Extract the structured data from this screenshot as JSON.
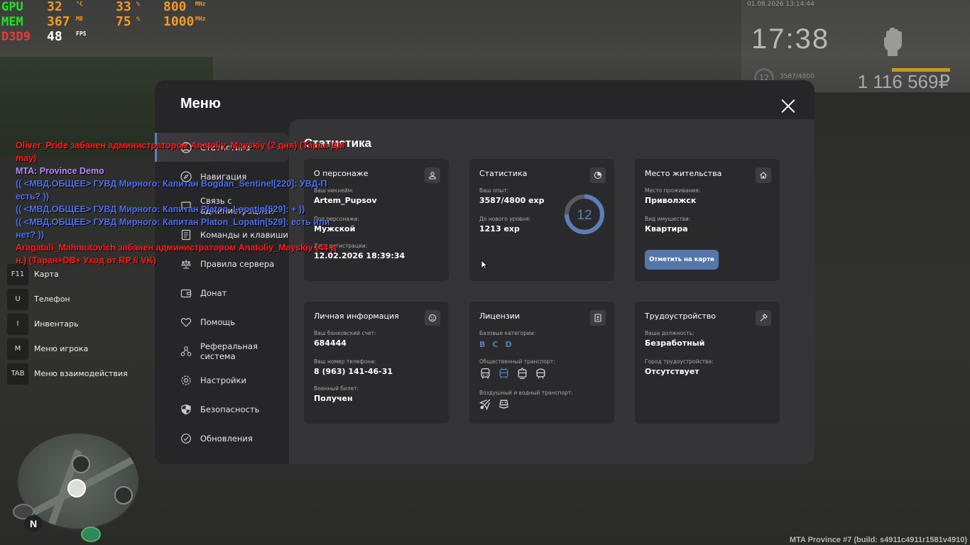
{
  "overlay": {
    "gpu": {
      "label": "GPU",
      "temp": "32",
      "temp_unit": "°C",
      "load": "33",
      "load_unit": "%",
      "clock": "800",
      "clock_unit": "MHz"
    },
    "mem": {
      "label": "MEM",
      "used": "367",
      "used_unit": "MB",
      "load": "75",
      "load_unit": "%",
      "clock": "1000",
      "clock_unit": "MHz"
    },
    "d3d": {
      "label": "D3D9",
      "fps": "48",
      "fps_unit": "FPS"
    }
  },
  "hud": {
    "date": "01.08.2026 13:14:44",
    "time": "17:38",
    "money": "1 116 569₽",
    "level": "12",
    "exp": "3587/4800"
  },
  "hotkeys": [
    {
      "key": "F11",
      "label": "Карта"
    },
    {
      "key": "U",
      "label": "Телефон"
    },
    {
      "key": "I",
      "label": "Инвентарь"
    },
    {
      "key": "M",
      "label": "Меню игрока"
    },
    {
      "key": "TAB",
      "label": "Меню взаимодействия"
    }
  ],
  "chat": [
    {
      "text": "Oliver_Pride забанен администратором Anatoliy_Mayskiy (2 дня) (Тарап ДМ",
      "color": "#ff1e1e"
    },
    {
      "text": " may)",
      "color": "#ff1e1e"
    },
    {
      "text": "MTA: Province Demo",
      "color": "#b88cff"
    },
    {
      "text": "(( <МВД.ОБЩЕЕ> ГУВД Мирного: Капитан Bogdan_Sentinel[220]: УВД-П",
      "color": "#4f6ff0"
    },
    {
      "text": " есть? ))",
      "color": "#4f6ff0"
    },
    {
      "text": "(( <МВД.ОБЩЕЕ> ГУВД Мирного: Капитан Platon_Lopatin[529]: + ))",
      "color": "#4f6ff0"
    },
    {
      "text": "(( <МВД.ОБЩЕЕ> ГУВД Мирного: Капитан Platon_Lopatin[529]: есть или",
      "color": "#4f6ff0"
    },
    {
      "text": " нет? ))",
      "color": "#4f6ff0"
    },
    {
      "text": "Aragatali_Mahmutovich забанен администратором Anatoliy_Mayskiy (44 д",
      "color": "#ff1e1e"
    },
    {
      "text": "н.) (Таран+DB+ Уход от RP // VK)",
      "color": "#ff1e1e"
    }
  ],
  "menu": {
    "title": "Меню",
    "items": [
      {
        "label": "Статистика",
        "icon": "user-circle-icon",
        "active": true
      },
      {
        "label": "Навигация",
        "icon": "compass-icon",
        "active": false
      },
      {
        "label": "Связь с администрацией",
        "icon": "chat-icon",
        "active": false
      },
      {
        "label": "Команды и клавиши",
        "icon": "keyboard-icon",
        "active": false
      },
      {
        "label": "Правила сервера",
        "icon": "scales-icon",
        "active": false
      },
      {
        "label": "Донат",
        "icon": "wallet-icon",
        "active": false
      },
      {
        "label": "Помощь",
        "icon": "heart-hand-icon",
        "active": false
      },
      {
        "label": "Реферальная система",
        "icon": "network-icon",
        "active": false
      },
      {
        "label": "Настройки",
        "icon": "gear-icon",
        "active": false
      },
      {
        "label": "Безопасность",
        "icon": "shield-icon",
        "active": false
      },
      {
        "label": "Обновления",
        "icon": "refresh-icon",
        "active": false
      }
    ]
  },
  "content": {
    "title": "Статистика",
    "about": {
      "title": "О персонаже",
      "icon": "person-badge-icon",
      "nick_label": "Ваш никнейм:",
      "nick": "Artem_Pupsov",
      "gender_label": "Пол персонажа:",
      "gender": "Мужской",
      "reg_label": "Дата регистрации:",
      "reg": "12.02.2026 18:39:34"
    },
    "stats": {
      "title": "Статистика",
      "icon": "pie-chart-icon",
      "exp_label": "Ваш опыт:",
      "exp": "3587/4800 exp",
      "next_label": "До нового уровня:",
      "next": "1213 exp",
      "level": "12",
      "progress": 0.747
    },
    "residence": {
      "title": "Место жительства",
      "icon": "house-icon",
      "place_label": "Место проживания:",
      "place": "Приволжск",
      "prop_label": "Вид имущества:",
      "prop": "Квартира",
      "button": "Отметить на карте"
    },
    "personal": {
      "title": "Личная информация",
      "icon": "face-icon",
      "bank_label": "Ваш банковский счет:",
      "bank": "684444",
      "phone_label": "Ваш номер телефона:",
      "phone": "8 (963) 141-46-31",
      "military_label": "Военный билет:",
      "military": "Получен"
    },
    "licenses": {
      "title": "Лицензии",
      "icon": "id-card-icon",
      "base_label": "Базовые категории:",
      "base": [
        "B",
        "C",
        "D"
      ],
      "public_label": "Общественный транспорт:",
      "public_icons": [
        "bus-icon",
        "trolleybus-icon",
        "tram-icon",
        "train-icon"
      ],
      "air_label": "Воздушный и водный транспорт:",
      "air_icons": [
        "plane-icon",
        "boat-icon"
      ]
    },
    "job": {
      "title": "Трудоустройство",
      "icon": "hammer-icon",
      "position_label": "Ваша должность:",
      "position": "Безработный",
      "city_label": "Город трудоустройства:",
      "city": "Отсутствует"
    }
  },
  "build": "MTA Province #7 (build: s4911c4911r1581v4910)",
  "colors": {
    "accent": "#5b7fb8",
    "modal_bg": "#262628",
    "content_bg": "#353538",
    "card_bg": "#2a2a2d"
  }
}
